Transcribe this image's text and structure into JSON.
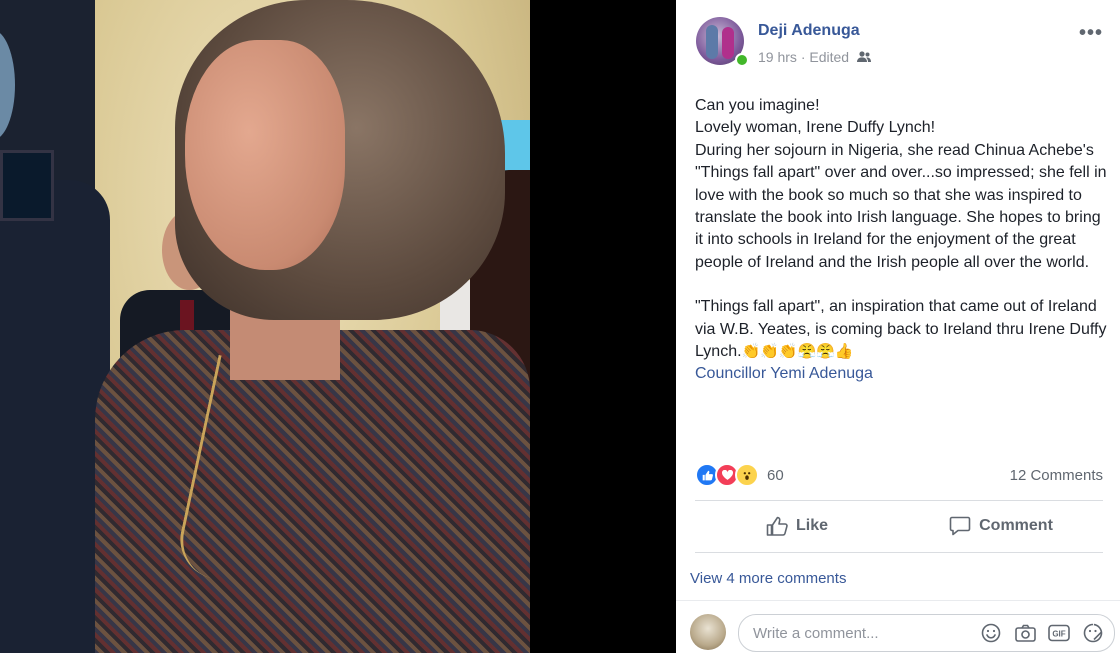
{
  "post": {
    "author": "Deji Adenuga",
    "time": "19 hrs",
    "edited": "Edited",
    "meta_sep": "·",
    "more_label": "•••",
    "lines": [
      "Can you imagine!",
      "Lovely woman, Irene Duffy Lynch!",
      "During her sojourn in Nigeria, she read Chinua Achebe's \"Things fall apart\" over and over...so impressed; she fell in love with the book so much so that she was inspired to translate the book into Irish language. She hopes to bring it into schools in Ireland for the enjoyment of the great people of Ireland and the Irish people all over the world."
    ],
    "para2": "\"Things fall apart\", an inspiration that came out of Ireland via W.B. Yeates, is coming back to Ireland thru Irene Duffy Lynch.",
    "emojis": "👏👏👏😤😤👍",
    "tag": "Councillor Yemi Adenuga"
  },
  "reactions": {
    "count": "60",
    "comments": "12 Comments"
  },
  "actions": {
    "like": "Like",
    "comment": "Comment"
  },
  "comments": {
    "view_more": "View 4 more comments",
    "placeholder": "Write a comment..."
  },
  "colors": {
    "link": "#385898",
    "muted": "#90949c",
    "like_blue": "#2078f4",
    "love_red": "#f33e58"
  }
}
